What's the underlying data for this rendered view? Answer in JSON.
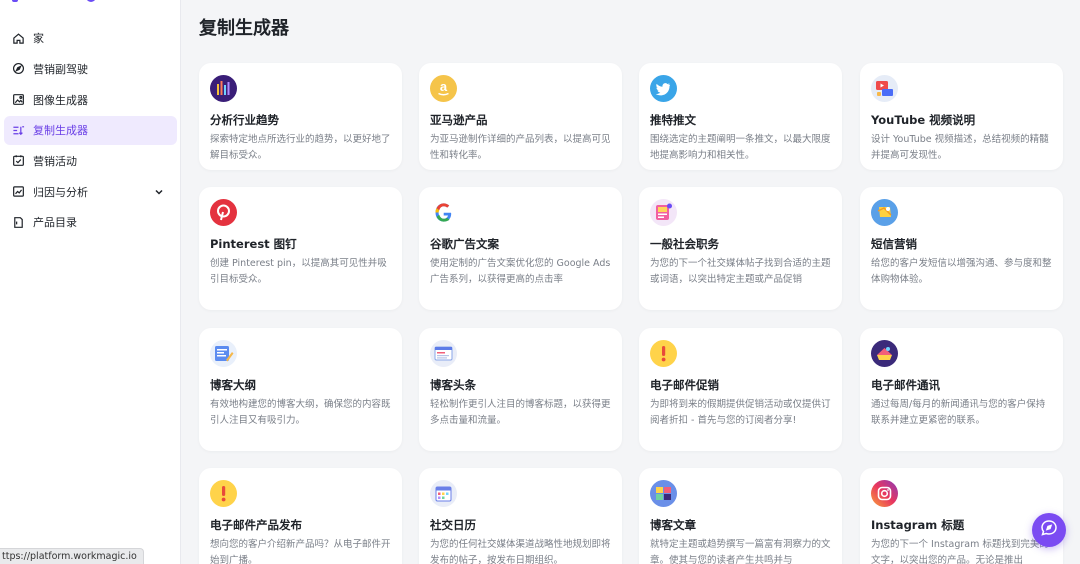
{
  "sidebar": {
    "items": [
      {
        "label": "家",
        "icon": "home-icon"
      },
      {
        "label": "营销副驾驶",
        "icon": "compass-icon"
      },
      {
        "label": "图像生成器",
        "icon": "image-icon"
      },
      {
        "label": "复制生成器",
        "icon": "text-generate-icon",
        "active": true
      },
      {
        "label": "营销活动",
        "icon": "calendar-check-icon"
      },
      {
        "label": "归因与分析",
        "icon": "chart-icon",
        "expandable": true
      },
      {
        "label": "产品目录",
        "icon": "document-icon"
      }
    ],
    "accent_color": "#6a3fe6"
  },
  "status_url": "ttps://platform.workmagic.io",
  "main": {
    "title": "复制生成器",
    "cards": [
      {
        "title": "分析行业趋势",
        "desc": "探索特定地点所选行业的趋势，以更好地了解目标受众。",
        "icon": "trend-bars-icon"
      },
      {
        "title": "亚马逊产品",
        "desc": "为亚马逊制作详细的产品列表，以提高可见性和转化率。",
        "icon": "amazon-icon"
      },
      {
        "title": "推特推文",
        "desc": "围绕选定的主题阐明一条推文，以最大限度地提高影响力和相关性。",
        "icon": "twitter-icon"
      },
      {
        "title": "YouTube 视频说明",
        "desc": "设计 YouTube 视频描述，总结视频的精髓并提高可发现性。",
        "icon": "youtube-icon"
      },
      {
        "title": "Pinterest 图钉",
        "desc": "创建 Pinterest pin，以提高其可见性并吸引目标受众。",
        "icon": "pinterest-icon"
      },
      {
        "title": "谷歌广告文案",
        "desc": "使用定制的广告文案优化您的 Google Ads 广告系列，以获得更高的点击率",
        "icon": "google-icon"
      },
      {
        "title": "一般社会职务",
        "desc": "为您的下一个社交媒体帖子找到合适的主题或词语，以突出特定主题或产品促销",
        "icon": "social-post-icon"
      },
      {
        "title": "短信营销",
        "desc": "给您的客户发短信以增强沟通、参与度和整体购物体验。",
        "icon": "sms-icon"
      },
      {
        "title": "博客大纲",
        "desc": "有效地构建您的博客大纲，确保您的内容既引人注目又有吸引力。",
        "icon": "blog-outline-icon"
      },
      {
        "title": "博客头条",
        "desc": "轻松制作更引人注目的博客标题，以获得更多点击量和流量。",
        "icon": "blog-headline-icon"
      },
      {
        "title": "电子邮件促销",
        "desc": "为即将到来的假期提供促销活动或仅提供订阅者折扣 - 首先与您的订阅者分享!",
        "icon": "email-promo-icon"
      },
      {
        "title": "电子邮件通讯",
        "desc": "通过每周/每月的新闻通讯与您的客户保持联系并建立更紧密的联系。",
        "icon": "newsletter-icon"
      },
      {
        "title": "电子邮件产品发布",
        "desc": "想向您的客户介绍新产品吗？从电子邮件开始到广播。",
        "icon": "product-launch-icon"
      },
      {
        "title": "社交日历",
        "desc": "为您的任何社交媒体渠道战略性地规划即将发布的帖子，按发布日期组织。",
        "icon": "calendar-icon"
      },
      {
        "title": "博客文章",
        "desc": "就特定主题或趋势撰写一篇富有洞察力的文章。使其与您的读者产生共鸣并与",
        "icon": "blog-article-icon"
      },
      {
        "title": "Instagram 标题",
        "desc": "为您的下一个 Instagram 标题找到完美的文字，以突出您的产品。无论是推出",
        "icon": "instagram-icon"
      }
    ]
  },
  "fab_icon": "chat-assistant-icon"
}
